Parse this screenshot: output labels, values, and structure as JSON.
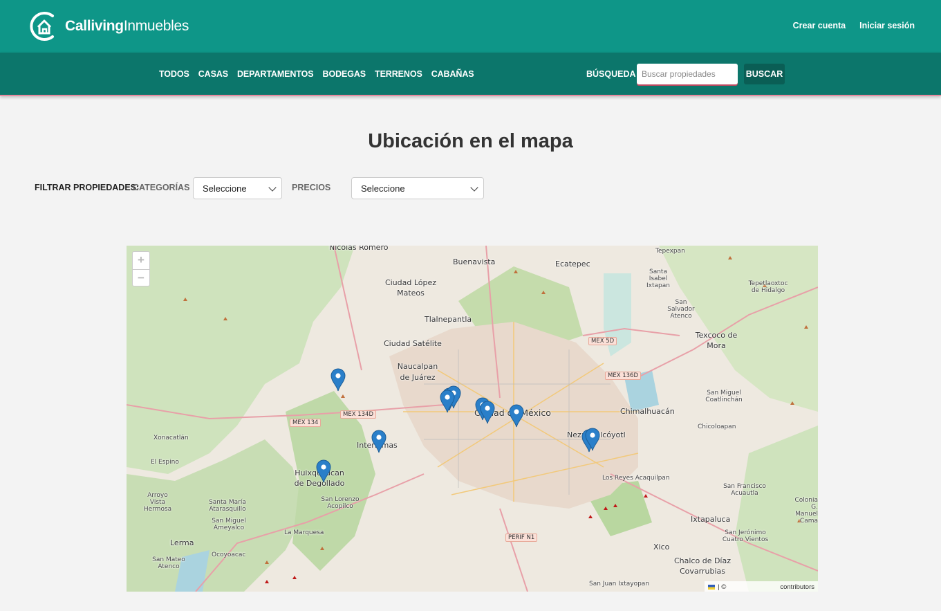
{
  "brand": {
    "name_bold": "Calliving",
    "name_regular": "Inmuebles",
    "logo_icon": "house-c-logo-icon"
  },
  "auth": {
    "create_account": "Crear cuenta",
    "login": "Iniciar sesión"
  },
  "nav": {
    "categories": [
      "TODOS",
      "CASAS",
      "DEPARTAMENTOS",
      "BODEGAS",
      "TERRENOS",
      "CABAÑAS"
    ],
    "search_label": "BÚSQUEDA",
    "search_placeholder": "Buscar propiedades",
    "search_button": "BUSCAR"
  },
  "page": {
    "title": "Ubicación en el mapa"
  },
  "filters": {
    "main_label": "FILTRAR PROPIEDADES:",
    "category_label": "CATEGORÍAS",
    "category_value": "Seleccione",
    "price_label": "PRECIOS",
    "price_value": "Seleccione"
  },
  "map": {
    "zoom_in": "+",
    "zoom_out": "−",
    "attribution": "contributors",
    "attribution_prefix": "| ©",
    "marker_count": 11,
    "labels": {
      "nicolas_romero": "Nicolás Romero",
      "buenavista": "Buenavista",
      "ecatepec": "Ecatepec",
      "ciudad_lopez_mateos": "Ciudad López Mateos",
      "tlalnepantla": "Tlalnepantla",
      "ciudad_satelite": "Ciudad Satélite",
      "naucalpan": "Naucalpan de Juárez",
      "ciudad_de_mexico": "Ciudad de México",
      "nezahualcoyotl": "Nezahualcóyotl",
      "chimalhuacan": "Chimalhuacán",
      "texcoco": "Texcoco de Mora",
      "interlomas": "Interlomas",
      "huixquilucan": "Huixquilucan de Degollado",
      "ixtapaluca": "Ixtapaluca",
      "chalco": "Chalco de Díaz Covarrubias",
      "lerma": "Lerma",
      "xico": "Xico",
      "los_reyes": "Los Reyes Acaquilpan",
      "santa_isabel": "Santa Isabel Ixtapan",
      "san_salvador": "San Salvador Atenco",
      "tepexpan": "Tepexpan",
      "tepetlaoxtoc": "Tepetlaoxtoc de Hidalgo",
      "san_miguel_coatlinchan": "San Miguel Coatlinchán",
      "chicoloapan": "Chicoloapan",
      "san_francisco": "San Francisco Acuautla",
      "xonacatlan": "Xonacatlán",
      "el_espino": "El Espino",
      "arroyo_vista": "Arroyo Vista Hermosa",
      "santa_maria": "Santa María Atarasquillo",
      "san_miguel_ameyalco": "San Miguel Ameyalco",
      "la_marquesa": "La Marquesa",
      "san_lorenzo": "San Lorenzo Acopilco",
      "ocoyoacac": "Ocoyoacac",
      "san_mateo": "San Mateo Atenco",
      "san_juan": "San Juan Ixtayopan",
      "san_jeronimo": "San Jerónimo Cuatro Vientos",
      "colonia": "Colonia G. Manuel Cama"
    },
    "roads": {
      "mex134": "MEX 134",
      "mex134d": "MEX 134D",
      "mex5d": "MEX 5D",
      "mex136d": "MEX 136D",
      "perif": "PERIF N1"
    }
  }
}
